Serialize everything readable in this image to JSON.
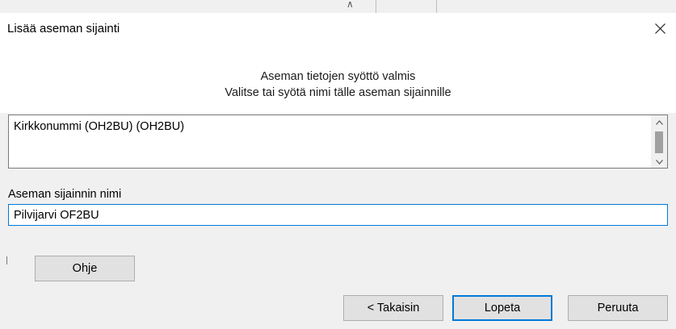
{
  "dialog": {
    "title": "Lisää aseman sijainti",
    "close_icon": "close-icon"
  },
  "banner": {
    "line1": "Aseman tietojen syöttö valmis",
    "line2": "Valitse tai syötä nimi tälle aseman sijainnille"
  },
  "locations": {
    "items": [
      "Kirkkonummi (OH2BU) (OH2BU)"
    ]
  },
  "location_name": {
    "label": "Aseman sijainnin nimi",
    "value": "Pilvijarvi OF2BU"
  },
  "buttons": {
    "help": "Ohje",
    "back": "< Takaisin",
    "finish": "Lopeta",
    "cancel": "Peruuta"
  },
  "colors": {
    "accent": "#0078d7",
    "button_bg": "#e1e1e1",
    "dialog_bg": "#f0f0f0"
  }
}
